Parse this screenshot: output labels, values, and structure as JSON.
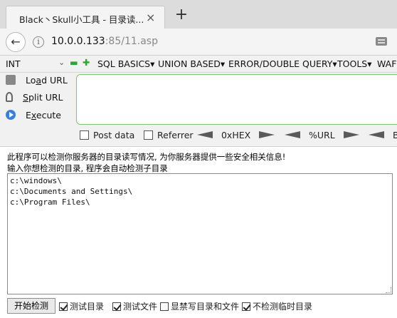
{
  "browser": {
    "tab_title": "Black丶Skull小工具 - 目录读...",
    "close_symbol": "×",
    "newtab_symbol": "+",
    "back_symbol": "←",
    "info_symbol": "i",
    "url_host": "10.0.0.133",
    "url_rest": ":85/11.asp"
  },
  "hackbar": {
    "int_label": "INT",
    "menu": [
      {
        "label": "SQL BASICS▾"
      },
      {
        "label": "UNION BASED▾"
      },
      {
        "label": "ERROR/DOUBLE QUERY▾"
      },
      {
        "label": "TOOLS▾"
      },
      {
        "label": "WAF"
      }
    ],
    "load_url_pre": "Lo",
    "load_url_u": "a",
    "load_url_post": "d URL",
    "split_url_u": "S",
    "split_url_post": "plit URL",
    "execute_pre": "E",
    "execute_u": "x",
    "execute_post": "ecute",
    "url_value": "",
    "post_data_label": "Post data",
    "referrer_label": "Referrer",
    "hex_label": "0xHEX",
    "url_enc_label": "%URL",
    "last_label": "B"
  },
  "page": {
    "line1": "此程序可以检测你服务器的目录读写情况, 为你服务器提供一些安全相关信息!",
    "line2": "输入你想检测的目录, 程序会自动检测子目录",
    "dir_list": "c:\\windows\\\nc:\\Documents and Settings\\\nc:\\Program Files\\",
    "start_button": "开始检测",
    "checks": [
      {
        "label": "测试目录",
        "checked": true
      },
      {
        "label": "测试文件",
        "checked": true
      },
      {
        "label": "显禁写目录和文件",
        "checked": false
      },
      {
        "label": "不检测临时目录",
        "checked": true
      }
    ]
  }
}
